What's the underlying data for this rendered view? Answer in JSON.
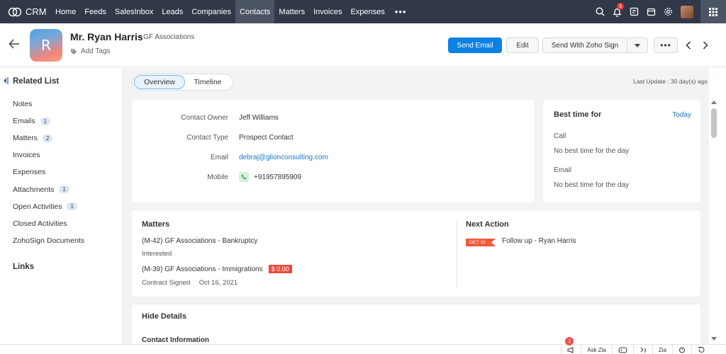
{
  "app": {
    "name": "CRM"
  },
  "nav": {
    "items": [
      "Home",
      "Feeds",
      "SalesInbox",
      "Leads",
      "Companies",
      "Contacts",
      "Matters",
      "Invoices",
      "Expenses"
    ],
    "active": "Contacts",
    "more": "•••"
  },
  "notifications": {
    "count": "3"
  },
  "record": {
    "initial": "R",
    "name": "Mr. Ryan Harris",
    "company": "GF Associations",
    "add_tags": "Add Tags"
  },
  "actions": {
    "send_email": "Send Email",
    "edit": "Edit",
    "send_with_zoho_sign": "Send With Zoho Sign",
    "more": "•••"
  },
  "sidebar": {
    "related_list_title": "Related List",
    "items": [
      {
        "label": "Notes",
        "badge": ""
      },
      {
        "label": "Emails",
        "badge": "1"
      },
      {
        "label": "Matters",
        "badge": "2"
      },
      {
        "label": "Invoices",
        "badge": ""
      },
      {
        "label": "Expenses",
        "badge": ""
      },
      {
        "label": "Attachments",
        "badge": "1"
      },
      {
        "label": "Open Activities",
        "badge": "1"
      },
      {
        "label": "Closed Activities",
        "badge": ""
      },
      {
        "label": "ZohoSign Documents",
        "badge": ""
      }
    ],
    "links_title": "Links"
  },
  "tabs": {
    "overview": "Overview",
    "timeline": "Timeline"
  },
  "last_update": "Last Update : 30 day(s) ago",
  "contact": {
    "fields": [
      {
        "label": "Contact Owner",
        "value": "Jeff Williams"
      },
      {
        "label": "Contact Type",
        "value": "Prospect Contact"
      },
      {
        "label": "Email",
        "value": "debraj@glionconsulting.com"
      },
      {
        "label": "Mobile",
        "value": "+91957895909"
      }
    ]
  },
  "best_time": {
    "title": "Best time for",
    "today": "Today",
    "call_label": "Call",
    "call_value": "No best time for the day",
    "email_label": "Email",
    "email_value": "No best time for the day"
  },
  "matters": {
    "title": "Matters",
    "items": [
      {
        "name": "(M-42) GF Associations - Bankruptcy",
        "status": "Interested"
      },
      {
        "name": "(M-39) GF Associations - Immigrations",
        "amount": "$ 0.00",
        "status": "Contract Signed",
        "date": "Oct 16, 2021"
      }
    ]
  },
  "next_action": {
    "title": "Next Action",
    "date_tag": "OCT 10",
    "text": "Follow up - Ryan Harris"
  },
  "details": {
    "hide_details": "Hide Details",
    "contact_information": "Contact Information"
  },
  "bottom_bar": {
    "badge": "1",
    "ask_zia": "Ask Zia",
    "zia_short": "Zia"
  }
}
